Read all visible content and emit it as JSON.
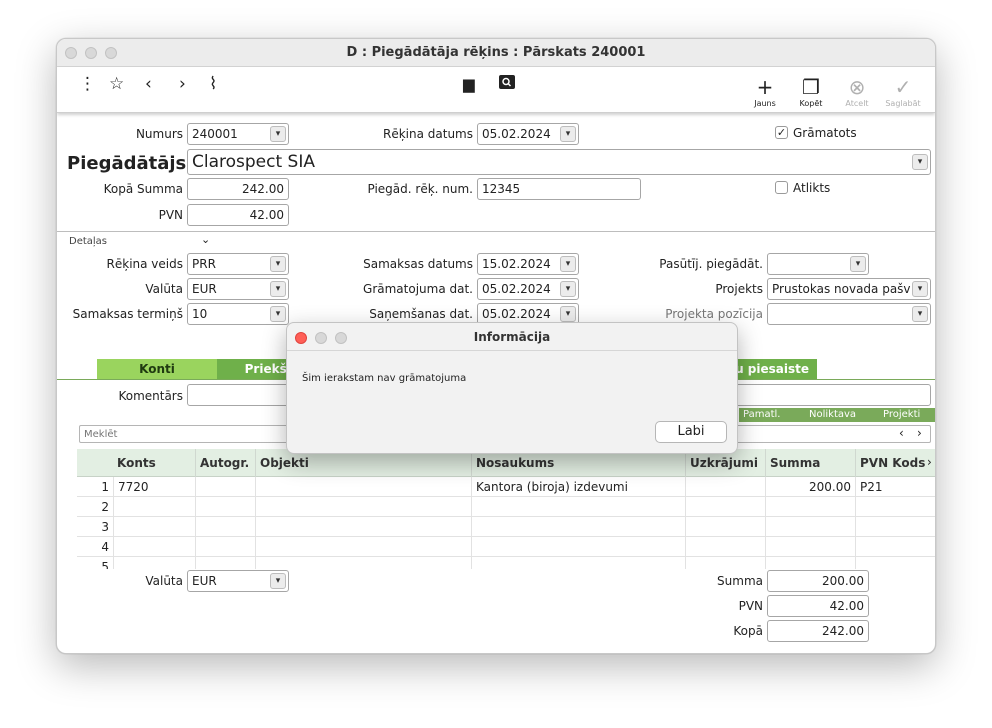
{
  "window": {
    "title": "D : Piegādātāja rēķins : Pārskats 240001"
  },
  "toolbar": {
    "new_label": "Jauns",
    "copy_label": "Kopēt",
    "cancel_label": "Atcelt",
    "save_label": "Saglabāt"
  },
  "header": {
    "number_label": "Numurs",
    "number_value": "240001",
    "invoice_date_label": "Rēķina datums",
    "invoice_date_value": "05.02.2024",
    "booked_label": "Grāmatots",
    "supplier_label": "Piegādātājs",
    "supplier_value": "Clarospect SIA",
    "total_label": "Kopā Summa",
    "total_value": "242.00",
    "supplier_inv_label": "Piegād. rēķ. num.",
    "supplier_inv_value": "12345",
    "postponed_label": "Atlikts",
    "vat_label": "PVN",
    "vat_value": "42.00"
  },
  "details": {
    "section_label": "Detaļas",
    "invoice_type_label": "Rēķina veids",
    "invoice_type_value": "PRR",
    "payment_date_label": "Samaksas datums",
    "payment_date_value": "15.02.2024",
    "order_supplier_label": "Pasūtīj. piegādāt.",
    "order_supplier_value": "",
    "currency_label": "Valūta",
    "currency_value": "EUR",
    "booking_date_label": "Grāmatojuma dat.",
    "booking_date_value": "05.02.2024",
    "project_label": "Projekts",
    "project_value": "Prustokas novada pašv",
    "payment_term_label": "Samaksas termiņš",
    "payment_term_value": "10",
    "receive_date_label": "Saņemšanas dat.",
    "receive_date_value": "05.02.2024",
    "project_pos_label": "Projekta pozīcija",
    "project_pos_value": ""
  },
  "tabs": [
    {
      "label": "Konti"
    },
    {
      "label": "Priekšapr"
    },
    {
      "label": "tsu piesaiste"
    }
  ],
  "comment_label": "Komentārs",
  "subtabs": [
    {
      "label": "Pamatl."
    },
    {
      "label": "Noliktava"
    },
    {
      "label": "Projekti"
    }
  ],
  "search": {
    "placeholder": "Meklēt"
  },
  "grid": {
    "columns": [
      "Konts",
      "Autogr.",
      "Objekti",
      "Nosaukums",
      "Uzkrājumi",
      "Summa",
      "PVN Kods"
    ],
    "rows": [
      {
        "n": "1",
        "konts": "7720",
        "nosaukums": "Kantora (biroja) izdevumi",
        "summa": "200.00",
        "pvn": "P21"
      },
      {
        "n": "2"
      },
      {
        "n": "3"
      },
      {
        "n": "4"
      },
      {
        "n": "5"
      }
    ]
  },
  "footer": {
    "currency_label": "Valūta",
    "currency_value": "EUR",
    "sum_label": "Summa",
    "sum_value": "200.00",
    "vat_label": "PVN",
    "vat_value": "42.00",
    "total_label": "Kopā",
    "total_value": "242.00"
  },
  "dialog": {
    "title": "Informācija",
    "message": "Šim ierakstam nav grāmatojuma",
    "ok_label": "Labi"
  },
  "colors": {
    "tab_active": "#9ad45e",
    "tab_inactive": "#6fb04a",
    "subtab_bar": "#7aaa5a",
    "grid_header": "#e3efe3"
  }
}
